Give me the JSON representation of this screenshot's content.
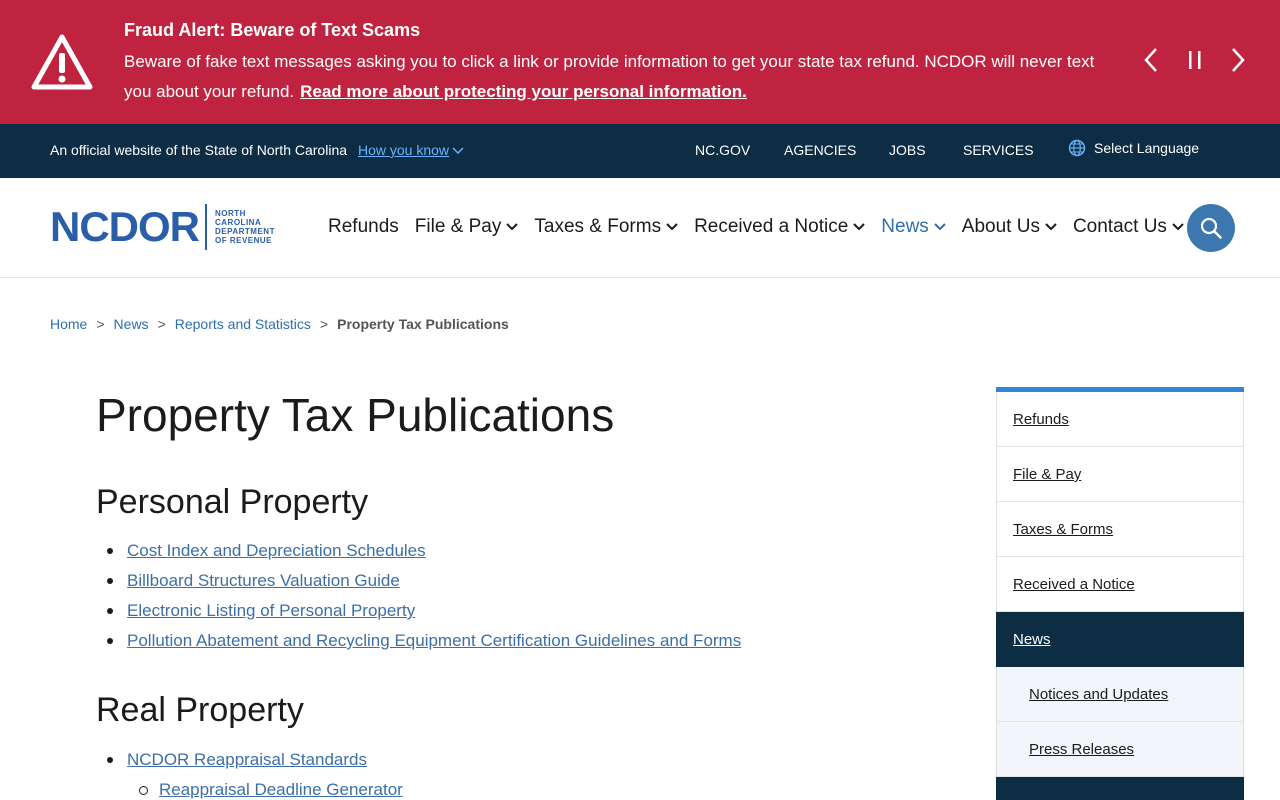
{
  "alert": {
    "title": "Fraud Alert: Beware of Text Scams",
    "body": "Beware of fake text messages asking you to click a link or provide information to get your state tax refund. NCDOR will never text you about your refund.",
    "link": "Read more about protecting your personal information."
  },
  "official_bar": {
    "text": "An official website of the State of North Carolina",
    "how_know": "How you know",
    "links": [
      "NC.GOV",
      "AGENCIES",
      "JOBS",
      "SERVICES"
    ],
    "language": "Select Language"
  },
  "logo": {
    "word": "NCDOR",
    "sub": [
      "NORTH",
      "CAROLINA",
      "DEPARTMENT",
      "OF REVENUE"
    ]
  },
  "nav": {
    "items": [
      {
        "label": "Refunds",
        "dropdown": false
      },
      {
        "label": "File & Pay",
        "dropdown": true
      },
      {
        "label": "Taxes & Forms",
        "dropdown": true
      },
      {
        "label": "Received a Notice",
        "dropdown": true
      },
      {
        "label": "News",
        "dropdown": true,
        "active": true
      },
      {
        "label": "About Us",
        "dropdown": true
      },
      {
        "label": "Contact Us",
        "dropdown": true
      }
    ]
  },
  "breadcrumb": {
    "items": [
      "Home",
      "News",
      "Reports and Statistics"
    ],
    "current": "Property Tax Publications"
  },
  "main": {
    "title": "Property Tax Publications",
    "sections": [
      {
        "title": "Personal Property",
        "links": [
          "Cost Index and Depreciation Schedules",
          "Billboard Structures Valuation Guide",
          "Electronic Listing of Personal Property",
          "Pollution Abatement and Recycling Equipment Certification Guidelines and Forms"
        ]
      },
      {
        "title": "Real Property",
        "links": [
          "NCDOR Reappraisal Standards"
        ],
        "sub_links": [
          "Reappraisal Deadline Generator"
        ]
      }
    ]
  },
  "sidenav": {
    "items": [
      "Refunds",
      "File & Pay",
      "Taxes & Forms",
      "Received a Notice",
      "News"
    ],
    "sub_items": [
      "Notices and Updates",
      "Press Releases"
    ]
  },
  "colors": {
    "alert_bg": "#c0233f",
    "official_bg": "#0d2d45",
    "brand_blue": "#2b5ea8",
    "link_blue": "#3d6fa6",
    "sidenav_accent": "#2f86d6"
  }
}
